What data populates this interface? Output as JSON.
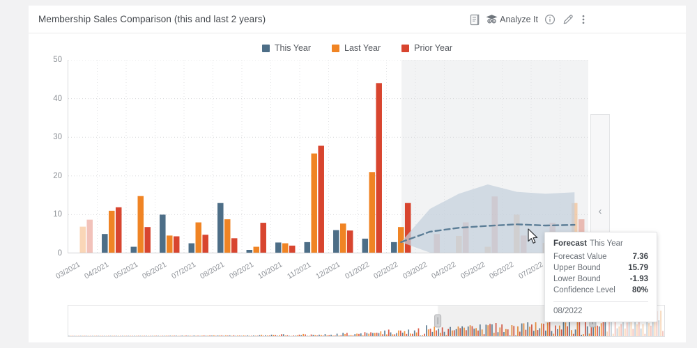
{
  "header": {
    "title": "Membership Sales Comparison (this and last 2 years)",
    "tools": [
      {
        "name": "report-icon",
        "label": ""
      },
      {
        "name": "analyze-it-icon",
        "label": "Analyze It"
      },
      {
        "name": "info-icon",
        "label": ""
      },
      {
        "name": "edit-icon",
        "label": ""
      },
      {
        "name": "more-options-icon",
        "label": ""
      }
    ],
    "analyze_label": "Analyze It"
  },
  "drawer": {
    "chevron": "‹"
  },
  "tooltip": {
    "title": "Forecast",
    "series": "This Year",
    "rows": [
      {
        "label": "Forecast Value",
        "value": "7.36"
      },
      {
        "label": "Upper Bound",
        "value": "15.79"
      },
      {
        "label": "Lower Bound",
        "value": "-1.93"
      },
      {
        "label": "Confidence Level",
        "value": "80%"
      }
    ],
    "date": "08/2022"
  },
  "colors": {
    "this_year": "#4d6e87",
    "last_year": "#f08424",
    "prior_year": "#d8452f",
    "forecast_line": "#5b7d96",
    "forecast_band": "#c3d0dc",
    "forecast_zone": "#f2f3f4"
  },
  "chart_data": {
    "type": "bar",
    "title": "Membership Sales Comparison (this and last 2 years)",
    "xlabel": "",
    "ylabel": "",
    "ylim": [
      0,
      50
    ],
    "yticks": [
      0,
      10,
      20,
      30,
      40,
      50
    ],
    "grid": true,
    "legend_position": "top-center",
    "categories": [
      "03/2021",
      "04/2021",
      "05/2021",
      "06/2021",
      "07/2021",
      "08/2021",
      "09/2021",
      "10/2021",
      "11/2021",
      "12/2021",
      "01/2022",
      "02/2022",
      "03/2022",
      "04/2022",
      "05/2022",
      "06/2022",
      "07/2022",
      "08/2022"
    ],
    "series": [
      {
        "name": "This Year",
        "color": "#4d6e87",
        "values": [
          null,
          5.0,
          1.7,
          10.0,
          2.6,
          13.0,
          0.9,
          2.8,
          2.9,
          6.0,
          3.8,
          2.9,
          null,
          null,
          null,
          null,
          null,
          null
        ]
      },
      {
        "name": "Last Year",
        "color": "#f08424",
        "values": [
          6.9,
          11.0,
          14.8,
          4.6,
          8.0,
          8.8,
          1.7,
          2.6,
          25.8,
          7.7,
          21.0,
          6.8,
          0.0,
          4.5,
          1.7,
          10.0,
          2.7,
          13.0
        ]
      },
      {
        "name": "Prior Year",
        "color": "#d8452f",
        "values": [
          8.7,
          11.9,
          6.8,
          4.4,
          4.8,
          3.9,
          7.9,
          2.0,
          27.8,
          5.9,
          44.0,
          13.0,
          5.0,
          8.0,
          14.7,
          4.6,
          7.9,
          8.8
        ]
      }
    ],
    "faded_months": [
      "03/2021",
      "03/2022",
      "04/2022",
      "05/2022",
      "06/2022",
      "07/2022",
      "08/2022"
    ],
    "forecast": {
      "series": "This Year",
      "starts_at": "02/2022",
      "x": [
        "02/2022",
        "03/2022",
        "04/2022",
        "05/2022",
        "06/2022",
        "07/2022",
        "08/2022"
      ],
      "value": [
        2.9,
        5.6,
        6.6,
        7.1,
        7.5,
        7.2,
        7.36
      ],
      "upper": [
        2.9,
        11.5,
        15.4,
        17.8,
        15.9,
        15.4,
        15.79
      ],
      "lower": [
        2.9,
        0.2,
        -0.7,
        -1.2,
        -1.4,
        -1.7,
        -1.93
      ],
      "confidence_level": "80%"
    }
  },
  "minimap": {
    "selection_start_pct": 62.0,
    "selection_end_pct": 88.0,
    "handle_left": "handle",
    "handle_right": "handle"
  }
}
